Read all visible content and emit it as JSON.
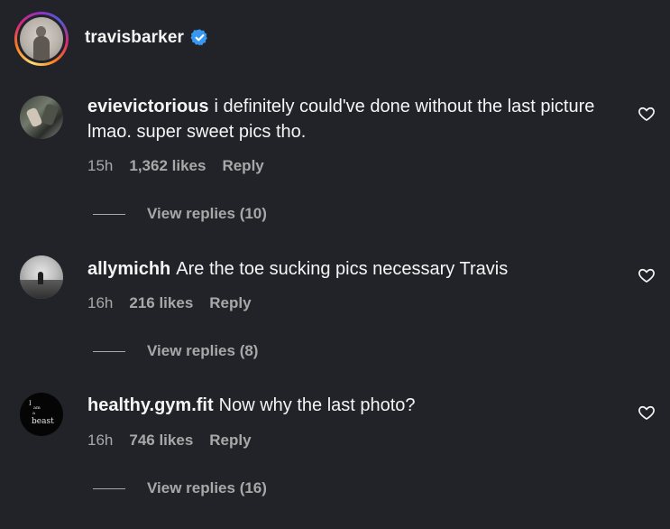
{
  "header": {
    "username": "travisbarker",
    "verified": true,
    "accent_color": "#3897f0"
  },
  "comments": [
    {
      "username": "evievictorious",
      "text": "i definitely could've done without the last picture lmao. super sweet pics tho.",
      "time": "15h",
      "likes": "1,362 likes",
      "reply_label": "Reply",
      "view_replies": "View replies (10)"
    },
    {
      "username": "allymichh",
      "text": "Are the toe sucking pics necessary Travis",
      "time": "16h",
      "likes": "216 likes",
      "reply_label": "Reply",
      "view_replies": "View replies (8)"
    },
    {
      "username": "healthy.gym.fit",
      "text": "Now why the last photo?",
      "time": "16h",
      "likes": "746 likes",
      "reply_label": "Reply",
      "view_replies": "View replies (16)",
      "avatar_text": [
        "I",
        "am",
        "a",
        "beast"
      ]
    }
  ]
}
